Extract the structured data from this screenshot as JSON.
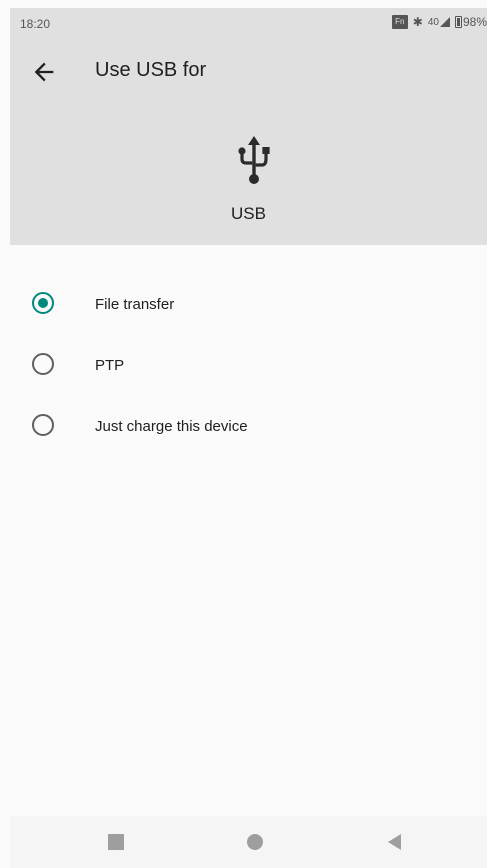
{
  "status_bar": {
    "time": "18:20",
    "fn_badge": "Fn",
    "bluetooth_glyph": "✱",
    "signal_text": "40",
    "battery_text": "98%"
  },
  "header": {
    "title": "Use USB for",
    "back_icon": "arrow-back-icon"
  },
  "device": {
    "icon": "usb-icon",
    "label": "USB"
  },
  "options": [
    {
      "label": "File transfer",
      "checked": true
    },
    {
      "label": "PTP",
      "checked": false
    },
    {
      "label": "Just charge this device",
      "checked": false
    }
  ],
  "nav_bar": {
    "recent_icon": "square-icon",
    "home_icon": "circle-icon",
    "back_icon": "triangle-back-icon"
  },
  "colors": {
    "accent": "#00897b",
    "header_background": "#e0e0e0",
    "page_background": "#fafafa"
  }
}
